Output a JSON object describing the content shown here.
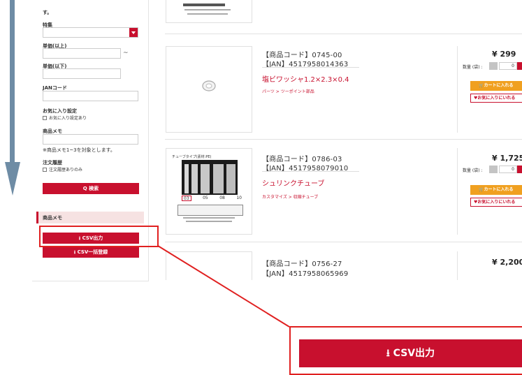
{
  "sidebar": {
    "top_text": "す。",
    "feature_label": "特集",
    "unit_price_min_label": "単価(以上)",
    "range_sep": "~",
    "unit_price_max_label": "単価(以下)",
    "jan_label": "JANコード",
    "favorite_label": "お気に入り設定",
    "favorite_checkbox": "お気に入り設定あり",
    "memo_label": "商品メモ",
    "memo_note": "※商品メモ1~3を対象とします。",
    "history_label": "注文履歴",
    "history_checkbox": "注文履歴ありのみ",
    "search_button": "Q 検索",
    "memo_section_title": "商品メモ",
    "csv_export": "CSV出力",
    "csv_bulk": "CSV一括登録"
  },
  "products": [
    {
      "code": "【商品コード】0745-00",
      "jan": "【JAN】4517958014363",
      "name": "塩ビワッシャ1.2×2.3×0.4",
      "category": "パーツ > ツーポイント部品",
      "price": "¥ 299",
      "qty_label": "数量 (袋) :",
      "qty": "0",
      "cart_button": "カートに入れる",
      "favorite_button": "お気に入りにいれる"
    },
    {
      "code": "【商品コード】0786-03",
      "jan": "【JAN】4517958079010",
      "name": "シュリンクチューブ",
      "category": "カスタマイズ > 収縮チューブ",
      "price": "¥ 1,725",
      "qty_label": "数量 (袋) :",
      "qty": "0",
      "cart_button": "カートに入れる",
      "favorite_button": "お気に入りにいれる",
      "image_caption": "チューブタイプ(素材:PE)",
      "sizes": [
        "03",
        "05",
        "08",
        "10"
      ]
    },
    {
      "code": "【商品コード】0756-27",
      "jan": "【JAN】4517958065969",
      "price": "¥ 2,200"
    }
  ],
  "zoom": {
    "label": "CSV出力"
  },
  "colors": {
    "brand_red": "#c8102e",
    "cart_orange": "#f0a020",
    "callout_red": "#e02020",
    "arrow_blue": "#6e8ca5"
  },
  "icons": [
    "download-icon",
    "search-icon",
    "cart-icon",
    "heart-icon",
    "scroll-down-arrow",
    "washer-image",
    "tube-image"
  ]
}
